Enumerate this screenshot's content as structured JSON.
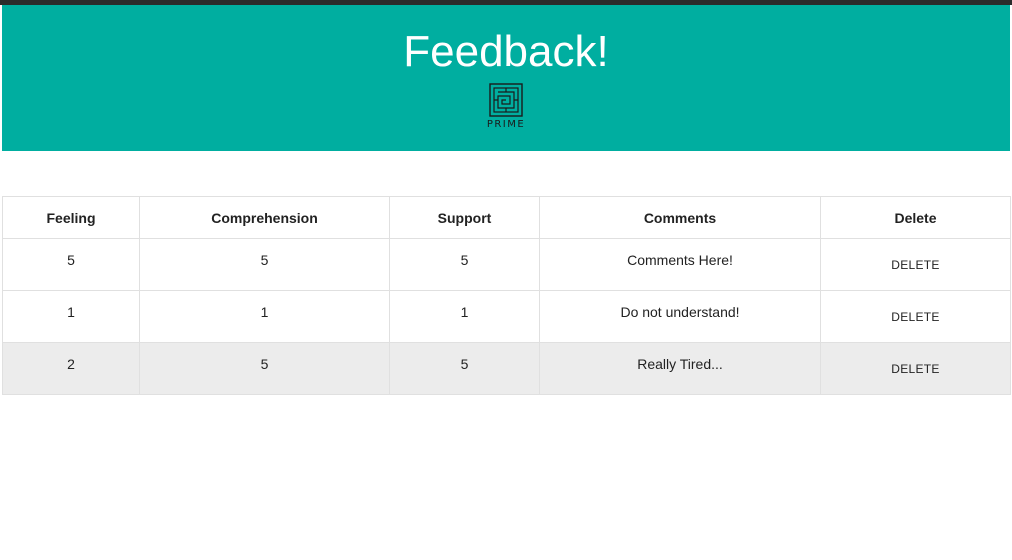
{
  "header": {
    "title": "Feedback!",
    "background_color": "#00aea0",
    "logo": {
      "icon": "prime-maze-logo-icon",
      "text": "PRIME"
    }
  },
  "table": {
    "columns": [
      "Feeling",
      "Comprehension",
      "Support",
      "Comments",
      "Delete"
    ],
    "rows": [
      {
        "feeling": "5",
        "comprehension": "5",
        "support": "5",
        "comments": "Comments Here!",
        "delete_label": "DELETE"
      },
      {
        "feeling": "1",
        "comprehension": "1",
        "support": "1",
        "comments": "Do not understand!",
        "delete_label": "DELETE"
      },
      {
        "feeling": "2",
        "comprehension": "5",
        "support": "5",
        "comments": "Really Tired...",
        "delete_label": "DELETE"
      }
    ],
    "striped_row_color": "#ececec"
  }
}
